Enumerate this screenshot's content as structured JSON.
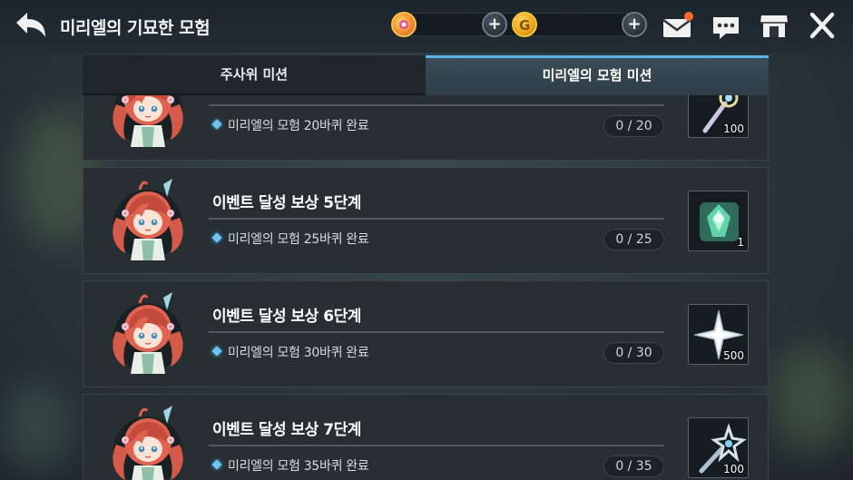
{
  "header": {
    "title": "미리엘의 기묘한 모험",
    "currency_1": {
      "icon": "gem-currency-icon",
      "value": ""
    },
    "currency_2": {
      "icon": "gold-coin-icon",
      "value": ""
    },
    "add_label": "+",
    "icons": [
      "back-arrow-icon",
      "mail-icon",
      "chat-icon",
      "shop-icon",
      "close-icon"
    ],
    "mail_has_notification": true
  },
  "tabs": [
    {
      "label": "주사위 미션",
      "active": false
    },
    {
      "label": "미리엘의 모험 미션",
      "active": true
    }
  ],
  "missions": [
    {
      "title": "",
      "desc": "미리엘의 모험 20바퀴 완료",
      "progress": "0 / 20",
      "reward_icon": "wand-icon",
      "reward_qty": "100"
    },
    {
      "title": "이벤트 달성 보상 5단계",
      "desc": "미리엘의 모험 25바퀴 완료",
      "progress": "0 / 25",
      "reward_icon": "green-crest-icon",
      "reward_qty": "1"
    },
    {
      "title": "이벤트 달성 보상 6단계",
      "desc": "미리엘의 모험 30바퀴 완료",
      "progress": "0 / 30",
      "reward_icon": "star-shard-icon",
      "reward_qty": "500"
    },
    {
      "title": "이벤트 달성 보상 7단계",
      "desc": "미리엘의 모험 35바퀴 완료",
      "progress": "0 / 35",
      "reward_icon": "star-wand-icon",
      "reward_qty": "100"
    }
  ],
  "colors": {
    "accent": "#59b7e8",
    "card_bg": "#272f33",
    "notification": "#ff6a2c"
  }
}
